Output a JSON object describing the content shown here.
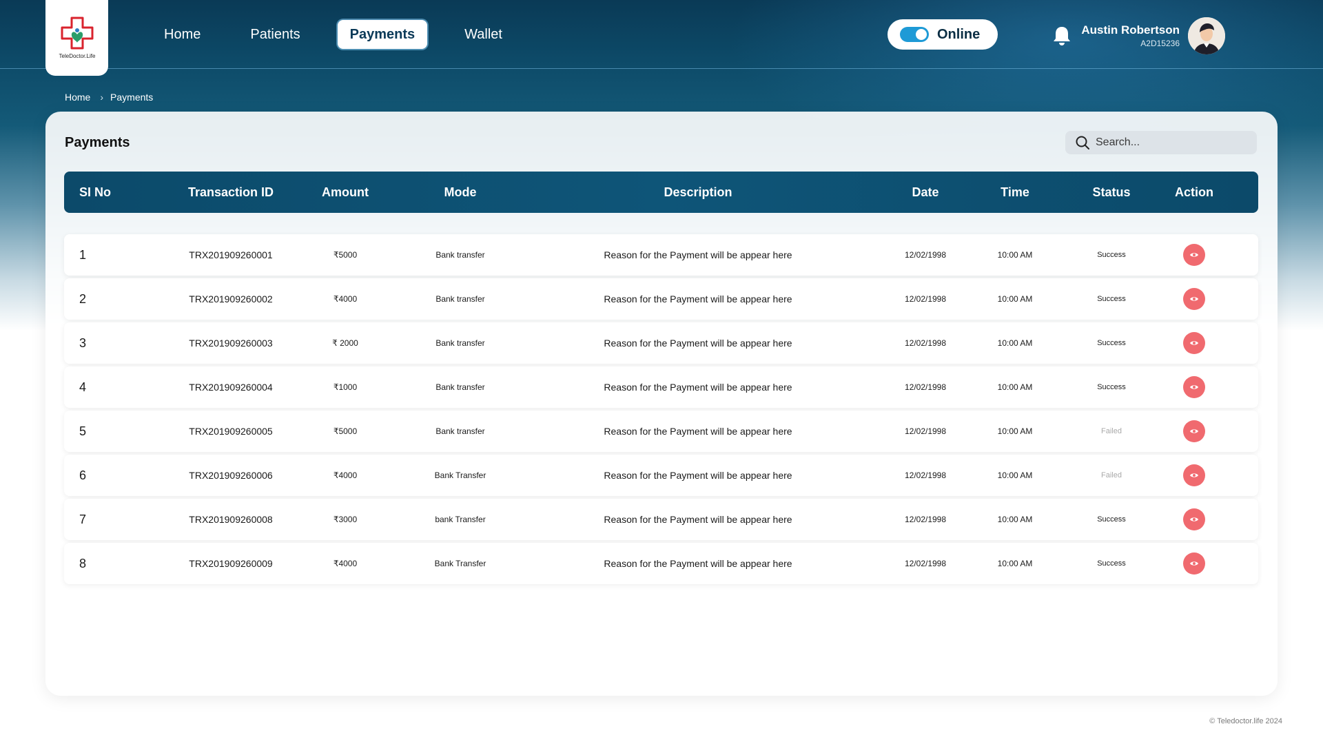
{
  "app": {
    "logo_text": "TeleDoctor.Life",
    "brand_colors": {
      "primary": "#0c4a6a",
      "accent": "#f06a6f",
      "toggle": "#1e9ad6"
    }
  },
  "nav": {
    "items": [
      {
        "label": "Home",
        "active": false
      },
      {
        "label": "Patients",
        "active": false
      },
      {
        "label": "Payments",
        "active": true
      },
      {
        "label": "Wallet",
        "active": false
      }
    ]
  },
  "status_toggle": {
    "label": "Online",
    "on": true
  },
  "user": {
    "name": "Austin Robertson",
    "id": "A2D15236"
  },
  "icons": {
    "notification": "bell-icon",
    "search": "search-icon",
    "view": "eye-icon",
    "breadcrumb_separator": "chevron-right-icon"
  },
  "breadcrumb": {
    "home": "Home",
    "current": "Payments"
  },
  "page": {
    "title": "Payments",
    "search_placeholder": "Search..."
  },
  "table": {
    "headers": {
      "sl": "SI No",
      "transaction_id": "Transaction ID",
      "amount": "Amount",
      "mode": "Mode",
      "description": "Description",
      "date": "Date",
      "time": "Time",
      "status": "Status",
      "action": "Action"
    },
    "rows": [
      {
        "sl": "1",
        "transaction_id": "TRX201909260001",
        "amount": "₹5000",
        "mode": "Bank transfer",
        "description": "Reason for the Payment will be appear here",
        "date": "12/02/1998",
        "time": "10:00 AM",
        "status": "Success"
      },
      {
        "sl": "2",
        "transaction_id": "TRX201909260002",
        "amount": "₹4000",
        "mode": "Bank transfer",
        "description": "Reason for the Payment will be appear here",
        "date": "12/02/1998",
        "time": "10:00 AM",
        "status": "Success"
      },
      {
        "sl": "3",
        "transaction_id": "TRX201909260003",
        "amount": "₹ 2000",
        "mode": "Bank transfer",
        "description": "Reason for the Payment will be appear here",
        "date": "12/02/1998",
        "time": "10:00 AM",
        "status": "Success"
      },
      {
        "sl": "4",
        "transaction_id": "TRX201909260004",
        "amount": "₹1000",
        "mode": "Bank transfer",
        "description": "Reason for the Payment will be appear here",
        "date": "12/02/1998",
        "time": "10:00 AM",
        "status": "Success"
      },
      {
        "sl": "5",
        "transaction_id": "TRX201909260005",
        "amount": "₹5000",
        "mode": "Bank transfer",
        "description": "Reason for the Payment will be appear here",
        "date": "12/02/1998",
        "time": "10:00 AM",
        "status": "Failed"
      },
      {
        "sl": "6",
        "transaction_id": "TRX201909260006",
        "amount": "₹4000",
        "mode": "Bank Transfer",
        "description": "Reason for the Payment will be appear here",
        "date": "12/02/1998",
        "time": "10:00 AM",
        "status": "Failed"
      },
      {
        "sl": "7",
        "transaction_id": "TRX201909260008",
        "amount": "₹3000",
        "mode": "bank Transfer",
        "description": "Reason for the Payment will be appear here",
        "date": "12/02/1998",
        "time": "10:00 AM",
        "status": "Success"
      },
      {
        "sl": "8",
        "transaction_id": "TRX201909260009",
        "amount": "₹4000",
        "mode": "Bank Transfer",
        "description": "Reason for the Payment will be appear here",
        "date": "12/02/1998",
        "time": "10:00 AM",
        "status": "Success"
      }
    ]
  },
  "footer": {
    "copyright": "© Teledoctor.life 2024"
  }
}
